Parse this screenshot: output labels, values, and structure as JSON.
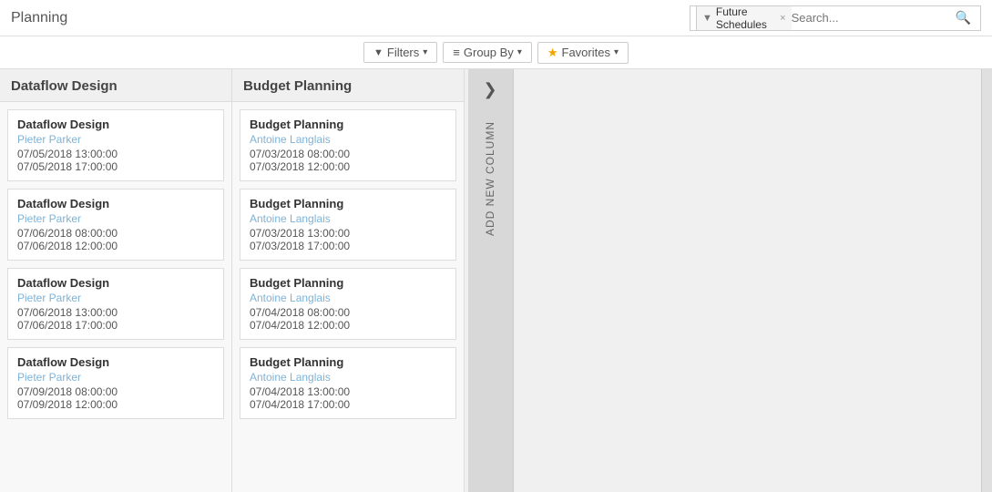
{
  "header": {
    "title": "Planning",
    "search_placeholder": "Search...",
    "filter_tag": "Future Schedules",
    "close_label": "×"
  },
  "toolbar": {
    "filters_label": "Filters",
    "groupby_label": "Group By",
    "favorites_label": "Favorites"
  },
  "columns": [
    {
      "id": "dataflow",
      "header": "Dataflow Design",
      "cards": [
        {
          "title": "Dataflow Design",
          "person": "Pieter Parker",
          "date1": "07/05/2018 13:00:00",
          "date2": "07/05/2018 17:00:00"
        },
        {
          "title": "Dataflow Design",
          "person": "Pieter Parker",
          "date1": "07/06/2018 08:00:00",
          "date2": "07/06/2018 12:00:00"
        },
        {
          "title": "Dataflow Design",
          "person": "Pieter Parker",
          "date1": "07/06/2018 13:00:00",
          "date2": "07/06/2018 17:00:00"
        },
        {
          "title": "Dataflow Design",
          "person": "Pieter Parker",
          "date1": "07/09/2018 08:00:00",
          "date2": "07/09/2018 12:00:00"
        }
      ]
    },
    {
      "id": "budget",
      "header": "Budget Planning",
      "cards": [
        {
          "title": "Budget Planning",
          "person": "Antoine Langlais",
          "date1": "07/03/2018 08:00:00",
          "date2": "07/03/2018 12:00:00"
        },
        {
          "title": "Budget Planning",
          "person": "Antoine Langlais",
          "date1": "07/03/2018 13:00:00",
          "date2": "07/03/2018 17:00:00"
        },
        {
          "title": "Budget Planning",
          "person": "Antoine Langlais",
          "date1": "07/04/2018 08:00:00",
          "date2": "07/04/2018 12:00:00"
        },
        {
          "title": "Budget Planning",
          "person": "Antoine Langlais",
          "date1": "07/04/2018 13:00:00",
          "date2": "07/04/2018 17:00:00"
        }
      ]
    }
  ],
  "add_column": {
    "label": "ADD NEW COLUMN"
  },
  "icons": {
    "funnel": "▼",
    "search": "🔍",
    "chevron_right": "❯",
    "filter": "▼",
    "list": "≡",
    "star": "★",
    "caret": "▾"
  }
}
